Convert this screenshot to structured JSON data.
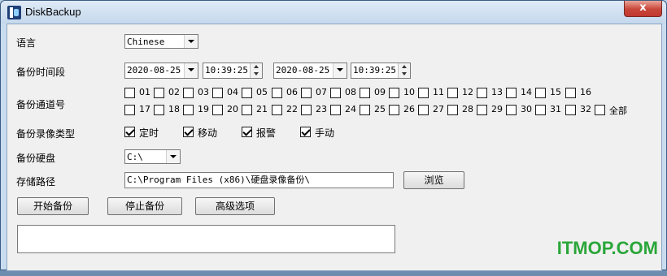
{
  "window": {
    "title": "DiskBackup",
    "close_glyph": "x"
  },
  "labels": {
    "language": "语言",
    "time_range": "备份时间段",
    "channels": "备份通道号",
    "record_type": "备份录像类型",
    "disk": "备份硬盘",
    "path": "存储路径"
  },
  "language_select": {
    "value": "Chinese"
  },
  "time_range": {
    "start_date": "2020-08-25",
    "start_time": "10:39:25",
    "end_date": "2020-08-25",
    "end_time": "10:39:25"
  },
  "channels": {
    "row1": [
      {
        "label": "01",
        "checked": false
      },
      {
        "label": "02",
        "checked": false
      },
      {
        "label": "03",
        "checked": false
      },
      {
        "label": "04",
        "checked": false
      },
      {
        "label": "05",
        "checked": false
      },
      {
        "label": "06",
        "checked": false
      },
      {
        "label": "07",
        "checked": false
      },
      {
        "label": "08",
        "checked": false
      },
      {
        "label": "09",
        "checked": false
      },
      {
        "label": "10",
        "checked": false
      },
      {
        "label": "11",
        "checked": false
      },
      {
        "label": "12",
        "checked": false
      },
      {
        "label": "13",
        "checked": false
      },
      {
        "label": "14",
        "checked": false
      },
      {
        "label": "15",
        "checked": false
      },
      {
        "label": "16",
        "checked": false
      }
    ],
    "row2": [
      {
        "label": "17",
        "checked": false
      },
      {
        "label": "18",
        "checked": false
      },
      {
        "label": "19",
        "checked": false
      },
      {
        "label": "20",
        "checked": false
      },
      {
        "label": "21",
        "checked": false
      },
      {
        "label": "22",
        "checked": false
      },
      {
        "label": "23",
        "checked": false
      },
      {
        "label": "24",
        "checked": false
      },
      {
        "label": "25",
        "checked": false
      },
      {
        "label": "26",
        "checked": false
      },
      {
        "label": "27",
        "checked": false
      },
      {
        "label": "28",
        "checked": false
      },
      {
        "label": "29",
        "checked": false
      },
      {
        "label": "30",
        "checked": false
      },
      {
        "label": "31",
        "checked": false
      },
      {
        "label": "32",
        "checked": false
      }
    ],
    "all_label": "全部",
    "all_checked": false
  },
  "record_types": [
    {
      "label": "定时",
      "checked": true
    },
    {
      "label": "移动",
      "checked": true
    },
    {
      "label": "报警",
      "checked": true
    },
    {
      "label": "手动",
      "checked": true
    }
  ],
  "disk_select": {
    "value": "C:\\"
  },
  "path": {
    "value": "C:\\Program Files (x86)\\硬盘录像备份\\",
    "browse_label": "浏览"
  },
  "buttons": {
    "start": "开始备份",
    "stop": "停止备份",
    "advanced": "高级选项"
  },
  "log": {
    "value": ""
  },
  "watermark": {
    "text": "ITMOP.COM",
    "color": "#2aa63a"
  }
}
